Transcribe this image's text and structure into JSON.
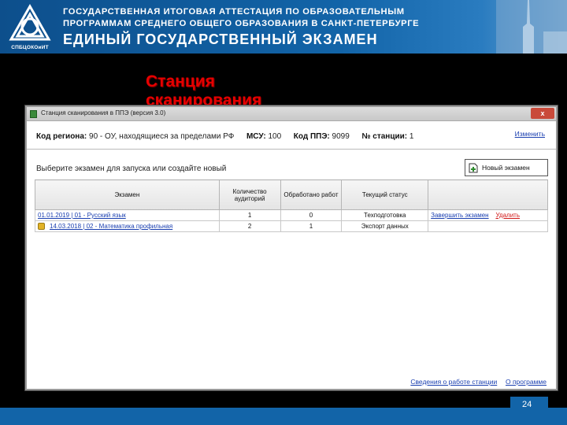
{
  "banner": {
    "logo_caption": "СПБЦОКОиИТ",
    "line1": "ГОСУДАРСТВЕННАЯ ИТОГОВАЯ АТТЕСТАЦИЯ ПО ОБРАЗОВАТЕЛЬНЫМ",
    "line2": "ПРОГРАММАМ СРЕДНЕГО ОБЩЕГО ОБРАЗОВАНИЯ В САНКТ-ПЕТЕРБУРГЕ",
    "line3": "ЕДИНЫЙ ГОСУДАРСТВЕННЫЙ ЭКЗАМЕН"
  },
  "slide": {
    "title": "Станция сканирования",
    "page_number": "24"
  },
  "window": {
    "title": "Станция сканирования в ППЭ (версия 3.0)",
    "close_label": "x"
  },
  "info": {
    "region_label": "Код региона:",
    "region_value": "90 - ОУ, находящиеся за пределами РФ",
    "msu_label": "МСУ:",
    "msu_value": "100",
    "ppe_label": "Код ППЭ:",
    "ppe_value": "9099",
    "station_label": "№ станции:",
    "station_value": "1",
    "change_link": "Изменить"
  },
  "choose_label": "Выберите экзамен для запуска или создайте новый",
  "new_exam_button": "Новый экзамен",
  "table": {
    "headers": [
      "Экзамен",
      "Количество аудиторий",
      "Обработано работ",
      "Текущий статус",
      ""
    ],
    "rows": [
      {
        "exam": "01.01.2019 | 01 - Русский язык",
        "auditoriums": "1",
        "processed": "0",
        "status": "Техподготовка",
        "action1": "Завершить экзамен",
        "action2": "Удалить",
        "locked": false
      },
      {
        "exam": "14.03.2018 | 02 - Математика профильная",
        "auditoriums": "2",
        "processed": "1",
        "status": "Экспорт данных",
        "action1": "",
        "action2": "",
        "locked": true
      }
    ]
  },
  "footer": {
    "station_info_link": "Сведения о работе станции",
    "about_link": "О программе"
  },
  "colors": {
    "banner_blue": "#1264a8",
    "title_red": "#e60000",
    "link_blue": "#1a3fb0",
    "delete_red": "#d01818"
  }
}
